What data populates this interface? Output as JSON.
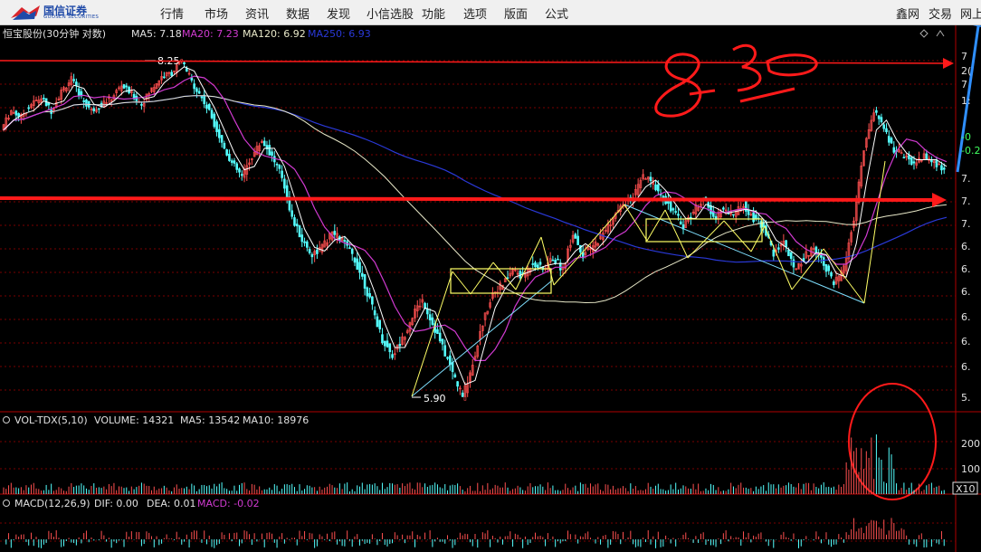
{
  "broker": {
    "name_cn": "国信证券",
    "name_en": "GUOSEN SECURITIES",
    "colors": {
      "brand_blue": "#1f4aa8",
      "brand_red": "#d9262c"
    }
  },
  "menu": {
    "items": [
      "行情",
      "市场",
      "资讯",
      "数据",
      "发现",
      "小信选股",
      "功能",
      "选项",
      "版面",
      "公式"
    ],
    "right": [
      "鑫网",
      "交易",
      "网上"
    ]
  },
  "price_panel": {
    "stock_title": "恒宝股份(30分钟 对数)",
    "ma5": "MA5: 7.18",
    "ma20": "MA20: 7.23",
    "ma120": "MA120: 6.92",
    "ma250": "MA250: 6.93",
    "high_label": "8.25",
    "low_label": "5.90",
    "right_axis": [
      "7",
      "2(",
      "7",
      "1:",
      "-0",
      "-0.2",
      "7.",
      "7.",
      "7.",
      "6.",
      "6.",
      "6.",
      "6.",
      "6.",
      "6.",
      "5."
    ],
    "annotation_text": "8.30"
  },
  "volume_panel": {
    "title": "VOL-TDX(5,10)",
    "volume": "VOLUME: 14321",
    "ma5": "MA5: 13542",
    "ma10": "MA10: 18976",
    "axis": [
      "200",
      "100"
    ],
    "scale": "X10"
  },
  "macd_panel": {
    "title": "MACD(12,26,9)",
    "dif": "DIF: 0.00",
    "dea": "DEA: 0.01",
    "macd": "MACD: -0.02"
  },
  "colors": {
    "ma5": "#ffffff",
    "ma20": "#d03ad0",
    "ma120": "#e8e8c8",
    "ma250": "#2a39d8",
    "up": "#ff5050",
    "down": "#54ffff",
    "grid": "#7a0000",
    "annotation": "#ff1a1a",
    "box": "#ffff66",
    "trend": "#7fe0ff"
  },
  "chart_data": {
    "type": "candlestick",
    "interval": "30分钟",
    "scale": "对数",
    "close": [
      7.7,
      7.85,
      7.8,
      7.9,
      7.95,
      7.85,
      8.0,
      8.1,
      7.95,
      7.85,
      7.9,
      7.95,
      8.05,
      7.98,
      7.9,
      8.02,
      8.12,
      8.15,
      8.25,
      8.08,
      7.95,
      7.8,
      7.6,
      7.45,
      7.35,
      7.5,
      7.62,
      7.5,
      7.35,
      7.05,
      6.9,
      6.8,
      6.85,
      6.95,
      6.9,
      6.8,
      6.65,
      6.45,
      6.25,
      6.15,
      6.25,
      6.4,
      6.5,
      6.35,
      6.2,
      6.05,
      5.9,
      6.1,
      6.35,
      6.55,
      6.6,
      6.7,
      6.65,
      6.75,
      6.7,
      6.78,
      6.7,
      6.95,
      6.8,
      6.85,
      6.95,
      7.05,
      7.15,
      7.2,
      7.35,
      7.3,
      7.2,
      7.1,
      7.0,
      7.1,
      7.2,
      7.05,
      7.12,
      7.08,
      7.15,
      7.05,
      7.0,
      6.8,
      6.9,
      6.7,
      6.78,
      6.85,
      6.75,
      6.6,
      6.7,
      7.05,
      7.55,
      7.85,
      7.7,
      7.55,
      7.5,
      7.45,
      7.5,
      7.45,
      7.4
    ],
    "ma_values": {
      "MA5": 7.18,
      "MA20": 7.23,
      "MA120": 6.92,
      "MA250": 6.93
    },
    "labels": {
      "high": 8.25,
      "low": 5.9
    },
    "volume": {
      "VOLUME": 14321,
      "MA5": 13542,
      "MA10": 18976
    },
    "macd": {
      "DIF": 0.0,
      "DEA": 0.01,
      "MACD": -0.02
    }
  }
}
